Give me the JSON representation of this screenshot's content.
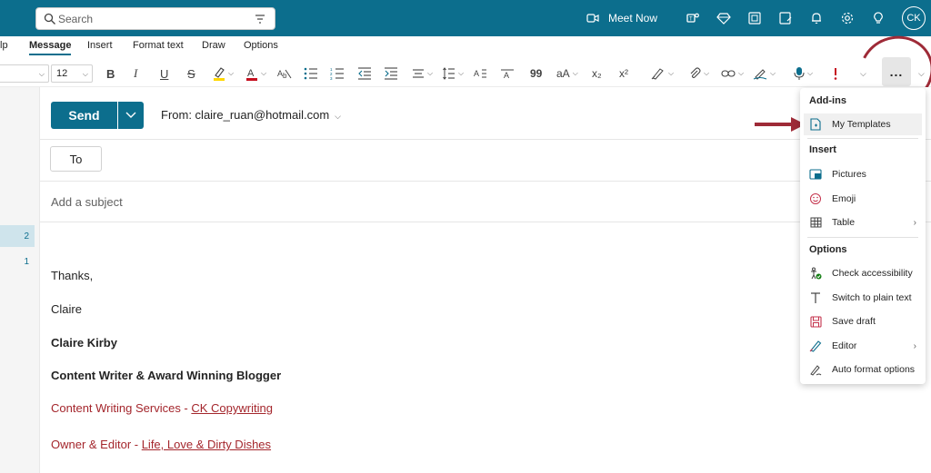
{
  "topbar": {
    "search_placeholder": "Search",
    "meet_now": "Meet Now",
    "avatar_initials": "CK",
    "bg_color": "#0c6e8d"
  },
  "tabs": [
    {
      "label": "lp"
    },
    {
      "label": "Message"
    },
    {
      "label": "Insert"
    },
    {
      "label": "Format text"
    },
    {
      "label": "Draw"
    },
    {
      "label": "Options"
    }
  ],
  "ribbon": {
    "font_size": "12",
    "bold": "B",
    "italic": "I",
    "underline": "U",
    "strike": "S",
    "quote": "99",
    "font_case": "aA",
    "subscript": "x₂",
    "superscript": "x²",
    "more": "..."
  },
  "folder_counts": [
    "2",
    "1"
  ],
  "compose": {
    "send_label": "Send",
    "from_label": "From: claire_ruan@hotmail.com",
    "to_label": "To",
    "subject_placeholder": "Add a subject",
    "signature": {
      "thanks": "Thanks,",
      "first_name": "Claire",
      "full_name": "Claire Kirby",
      "title": "Content Writer & Award Winning Blogger",
      "line1_prefix": "Content Writing Services - ",
      "line1_link": "CK Copywriting",
      "line2_prefix": "Owner & Editor - ",
      "line2_link": "Life, Love & Dirty Dishes"
    }
  },
  "menu": {
    "addins_header": "Add-ins",
    "my_templates": "My Templates",
    "insert_header": "Insert",
    "pictures": "Pictures",
    "emoji": "Emoji",
    "table": "Table",
    "options_header": "Options",
    "check_accessibility": "Check accessibility",
    "plain_text": "Switch to plain text",
    "save_draft": "Save draft",
    "editor": "Editor",
    "auto_format": "Auto format options"
  },
  "colors": {
    "accent": "#0c6e8d",
    "annotation": "#9e2a37",
    "signature_red": "#a4262c"
  }
}
